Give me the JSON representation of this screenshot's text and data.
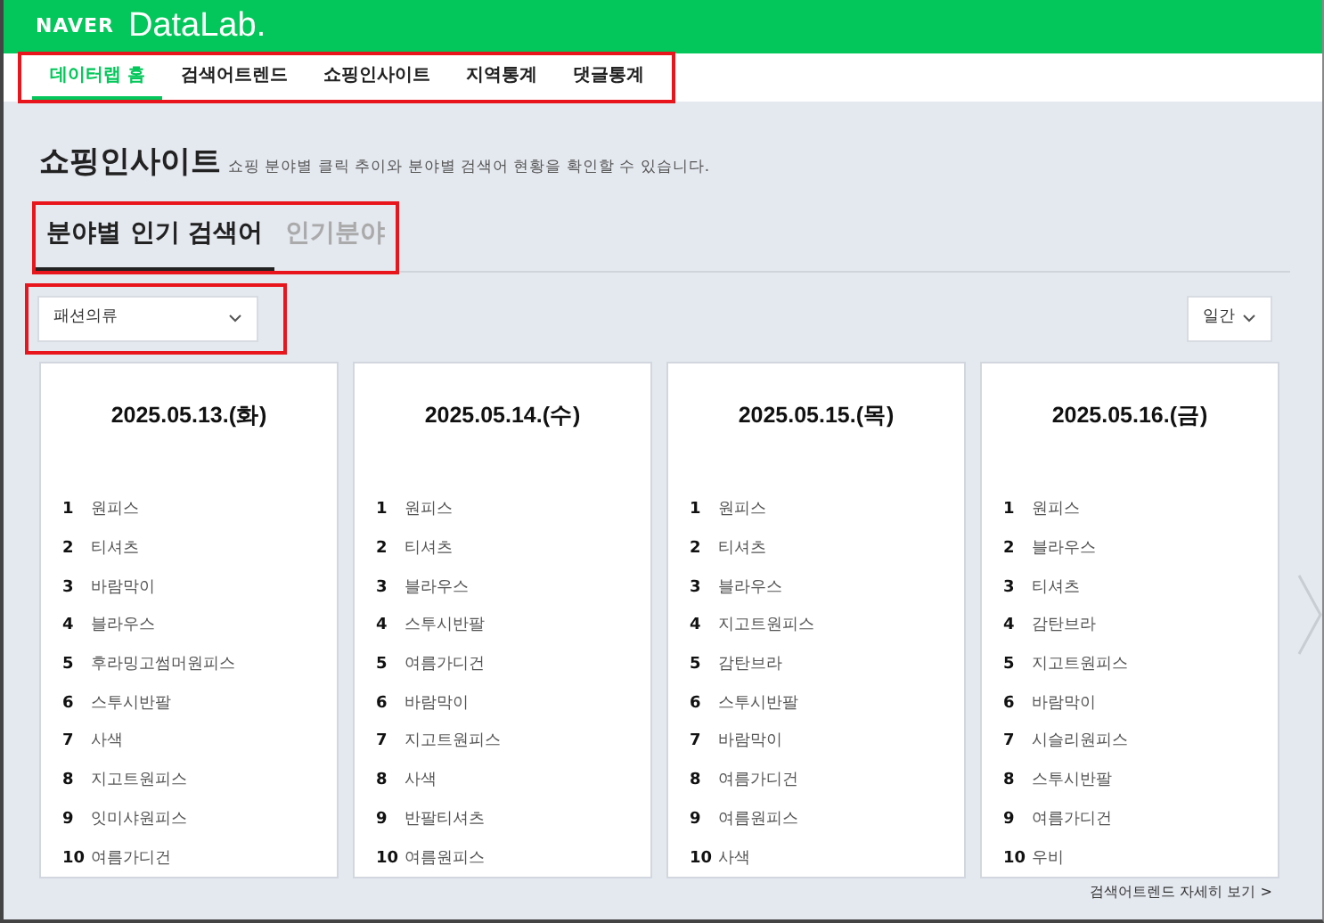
{
  "header": {
    "brand": "NAVER",
    "product": "DataLab."
  },
  "nav": {
    "highlighted": true,
    "items": [
      {
        "label": "데이터랩 홈",
        "selected": true
      },
      {
        "label": "검색어트렌드",
        "selected": false
      },
      {
        "label": "쇼핑인사이트",
        "selected": false
      },
      {
        "label": "지역통계",
        "selected": false
      },
      {
        "label": "댓글통계",
        "selected": false
      }
    ]
  },
  "page": {
    "title": "쇼핑인사이트",
    "subtitle": "쇼핑 분야별 클릭 추이와 분야별 검색어 현황을 확인할 수 있습니다."
  },
  "tabs": {
    "highlighted": true,
    "items": [
      {
        "label": "분야별 인기 검색어",
        "selected": true
      },
      {
        "label": "인기분야",
        "selected": false
      }
    ]
  },
  "category_select": {
    "value": "패션의류",
    "highlighted": true
  },
  "period_select": {
    "value": "일간"
  },
  "cards": [
    {
      "date": "2025.05.13.(화)",
      "keywords": [
        {
          "rank": "1",
          "keyword": "원피스"
        },
        {
          "rank": "2",
          "keyword": "티셔츠"
        },
        {
          "rank": "3",
          "keyword": "바람막이"
        },
        {
          "rank": "4",
          "keyword": "블라우스"
        },
        {
          "rank": "5",
          "keyword": "후라밍고썸머원피스"
        },
        {
          "rank": "6",
          "keyword": "스투시반팔"
        },
        {
          "rank": "7",
          "keyword": "사색"
        },
        {
          "rank": "8",
          "keyword": "지고트원피스"
        },
        {
          "rank": "9",
          "keyword": "잇미샤원피스"
        },
        {
          "rank": "10",
          "keyword": "여름가디건"
        }
      ]
    },
    {
      "date": "2025.05.14.(수)",
      "keywords": [
        {
          "rank": "1",
          "keyword": "원피스"
        },
        {
          "rank": "2",
          "keyword": "티셔츠"
        },
        {
          "rank": "3",
          "keyword": "블라우스"
        },
        {
          "rank": "4",
          "keyword": "스투시반팔"
        },
        {
          "rank": "5",
          "keyword": "여름가디건"
        },
        {
          "rank": "6",
          "keyword": "바람막이"
        },
        {
          "rank": "7",
          "keyword": "지고트원피스"
        },
        {
          "rank": "8",
          "keyword": "사색"
        },
        {
          "rank": "9",
          "keyword": "반팔티셔츠"
        },
        {
          "rank": "10",
          "keyword": "여름원피스"
        }
      ]
    },
    {
      "date": "2025.05.15.(목)",
      "keywords": [
        {
          "rank": "1",
          "keyword": "원피스"
        },
        {
          "rank": "2",
          "keyword": "티셔츠"
        },
        {
          "rank": "3",
          "keyword": "블라우스"
        },
        {
          "rank": "4",
          "keyword": "지고트원피스"
        },
        {
          "rank": "5",
          "keyword": "감탄브라"
        },
        {
          "rank": "6",
          "keyword": "스투시반팔"
        },
        {
          "rank": "7",
          "keyword": "바람막이"
        },
        {
          "rank": "8",
          "keyword": "여름가디건"
        },
        {
          "rank": "9",
          "keyword": "여름원피스"
        },
        {
          "rank": "10",
          "keyword": "사색"
        }
      ]
    },
    {
      "date": "2025.05.16.(금)",
      "keywords": [
        {
          "rank": "1",
          "keyword": "원피스"
        },
        {
          "rank": "2",
          "keyword": "블라우스"
        },
        {
          "rank": "3",
          "keyword": "티셔츠"
        },
        {
          "rank": "4",
          "keyword": "감탄브라"
        },
        {
          "rank": "5",
          "keyword": "지고트원피스"
        },
        {
          "rank": "6",
          "keyword": "바람막이"
        },
        {
          "rank": "7",
          "keyword": "시슬리원피스"
        },
        {
          "rank": "8",
          "keyword": "스투시반팔"
        },
        {
          "rank": "9",
          "keyword": "여름가디건"
        },
        {
          "rank": "10",
          "keyword": "우비"
        }
      ]
    }
  ],
  "footer_link": "검색어트렌드 자세히 보기 >"
}
